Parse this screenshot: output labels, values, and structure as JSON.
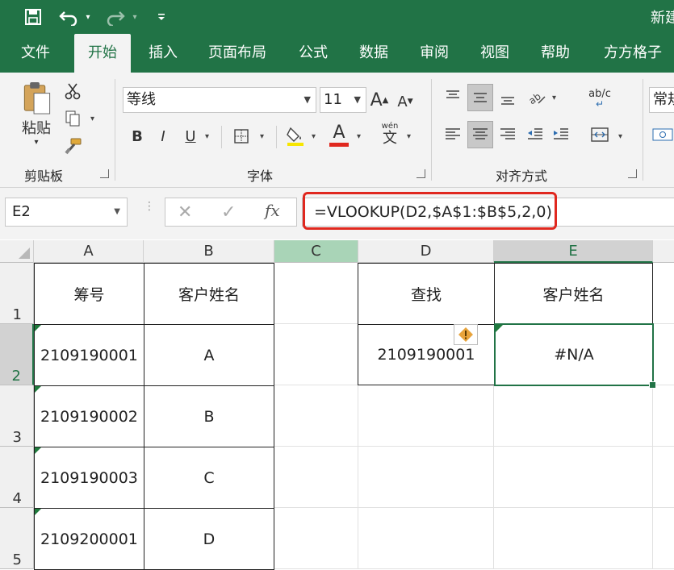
{
  "window": {
    "title": "新建"
  },
  "quick_access": {
    "save_icon": "save-icon",
    "undo_icon": "undo-icon",
    "redo_icon": "redo-icon",
    "customize_icon": "customize-icon"
  },
  "tabs": [
    {
      "label": "文件"
    },
    {
      "label": "开始"
    },
    {
      "label": "插入"
    },
    {
      "label": "页面布局"
    },
    {
      "label": "公式"
    },
    {
      "label": "数据"
    },
    {
      "label": "审阅"
    },
    {
      "label": "视图"
    },
    {
      "label": "帮助"
    },
    {
      "label": "方方格子"
    }
  ],
  "active_tab": "开始",
  "ribbon": {
    "clipboard": {
      "label": "剪贴板",
      "paste_label": "粘贴"
    },
    "font": {
      "label": "字体",
      "font_name": "等线",
      "font_size": "11",
      "bold": "B",
      "italic": "I",
      "underline": "U",
      "font_color_glyph": "A",
      "phonetic_glyph": "wén"
    },
    "alignment": {
      "label": "对齐方式",
      "wrap_glyph": "ab/c"
    },
    "number": {
      "format": "常规"
    }
  },
  "formula_bar": {
    "name_box": "E2",
    "fx": "fx",
    "formula": "=VLOOKUP(D2,$A$1:$B$5,2,0)"
  },
  "columns": [
    "A",
    "B",
    "C",
    "D",
    "E"
  ],
  "rows": [
    "1",
    "2",
    "3",
    "4",
    "5"
  ],
  "table_left": {
    "headers": [
      "筹号",
      "客户姓名"
    ],
    "rows": [
      [
        "2109190001",
        "A"
      ],
      [
        "2109190002",
        "B"
      ],
      [
        "2109190003",
        "C"
      ],
      [
        "2109200001",
        "D"
      ]
    ]
  },
  "table_right": {
    "headers": [
      "查找",
      "客户姓名"
    ],
    "lookup_value": "2109190001",
    "result": "#N/A"
  },
  "colors": {
    "excel_green": "#217346",
    "highlight_red": "#e0281f",
    "error_icon": "#e8a33b"
  }
}
